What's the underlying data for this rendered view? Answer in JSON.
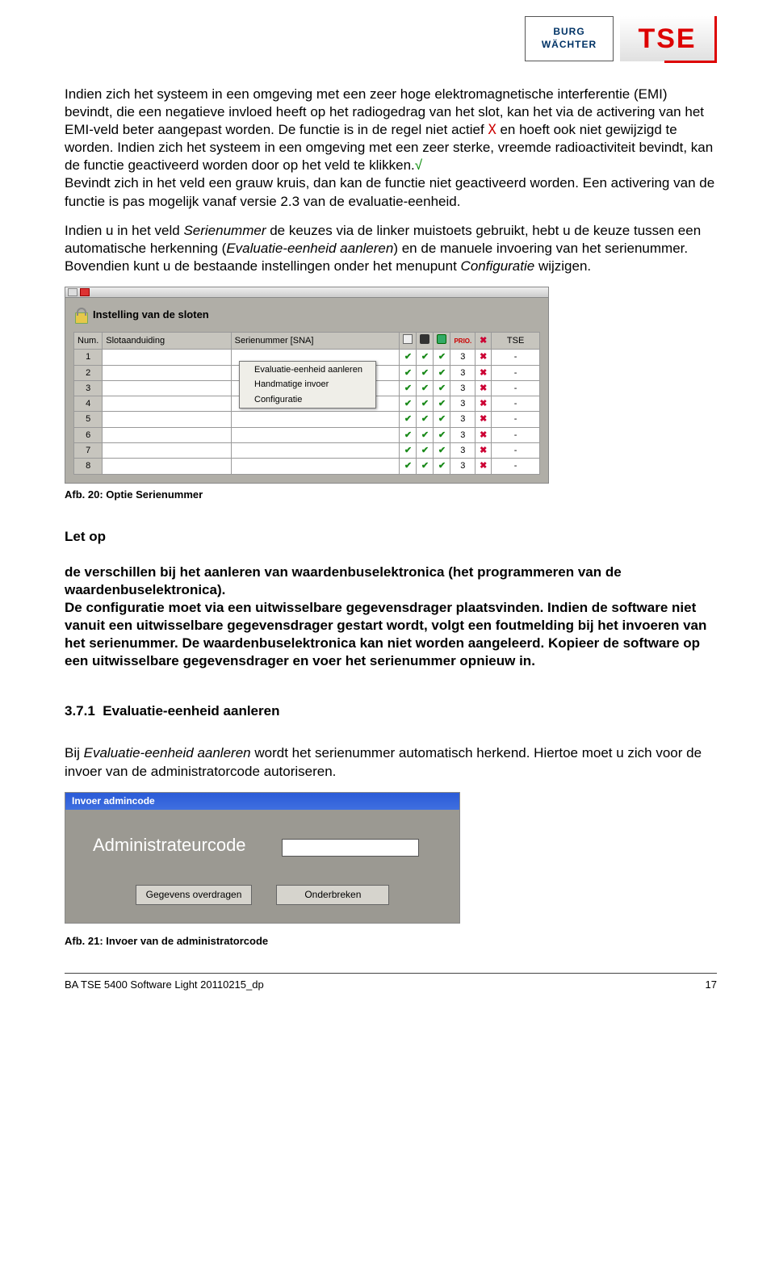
{
  "logo": {
    "bw_line1": "BURG",
    "bw_line2": "WÄCHTER",
    "tse": "TSE"
  },
  "para1_a": "Indien zich het systeem in een omgeving met een zeer hoge elektromagnetische interferentie (EMI) bevindt, die een negatieve invloed heeft op het radiogedrag van het slot, kan het via de activering van het EMI-veld beter aangepast worden. De functie is in de regel niet actief ",
  "para1_x": "X",
  "para1_b": " en hoeft ook niet gewijzigd te worden. Indien zich het systeem in een omgeving met een zeer sterke, vreemde radioactiviteit bevindt, kan de functie geactiveerd worden door op het veld te klikken.",
  "para1_tick": "√",
  "para1_c": "Bevindt zich in het veld een grauw kruis, dan kan de functie niet geactiveerd worden. Een activering van de functie is pas mogelijk vanaf versie 2.3 van de evaluatie-eenheid.",
  "para2_a": "Indien u in het veld ",
  "para2_ital1": "Serienummer",
  "para2_b": " de keuzes via de linker muistoets gebruikt, hebt u de keuze tussen een automatische herkenning (",
  "para2_ital2": "Evaluatie-eenheid aanleren",
  "para2_c": ") en de manuele invoering van het serienummer. Bovendien kunt u de bestaande instellingen onder het menupunt ",
  "para2_ital3": "Configuratie",
  "para2_d": " wijzigen.",
  "shot1": {
    "title": "Instelling van de sloten",
    "headers": {
      "num": "Num.",
      "sa": "Slotaanduiding",
      "sn": "Serienummer [SNA]",
      "pri": "PRIO.",
      "tse": "TSE"
    },
    "ctx": {
      "m1": "Evaluatie-eenheid aanleren",
      "m2": "Handmatige invoer",
      "m3": "Configuratie"
    },
    "rows": [
      {
        "n": "1",
        "p": "3",
        "t": "-"
      },
      {
        "n": "2",
        "p": "3",
        "t": "-"
      },
      {
        "n": "3",
        "p": "3",
        "t": "-"
      },
      {
        "n": "4",
        "p": "3",
        "t": "-"
      },
      {
        "n": "5",
        "p": "3",
        "t": "-"
      },
      {
        "n": "6",
        "p": "3",
        "t": "-"
      },
      {
        "n": "7",
        "p": "3",
        "t": "-"
      },
      {
        "n": "8",
        "p": "3",
        "t": "-"
      }
    ]
  },
  "caption1": "Afb. 20: Optie Serienummer",
  "letop": "Let op",
  "bold_para": " de verschillen bij het aanleren van waardenbuselektronica (het programmeren van de waardenbuselektronica).\nDe configuratie moet via een uitwisselbare gegevensdrager plaatsvinden. Indien de software niet vanuit een uitwisselbare gegevensdrager gestart wordt, volgt een foutmelding bij het invoeren van het serienummer. De waardenbuselektronica kan niet worden aangeleerd. Kopieer de software op een uitwisselbare gegevensdrager en voer het serienummer opnieuw in.",
  "section_num": "3.7.1",
  "section_title": "Evaluatie-eenheid aanleren",
  "para3_a": "Bij ",
  "para3_ital": "Evaluatie-eenheid aanleren",
  "para3_b": " wordt het serienummer automatisch herkend. Hiertoe moet u zich voor de invoer van de administratorcode autoriseren.",
  "shot2": {
    "title": "Invoer admincode",
    "label": "Administrateurcode",
    "btn1": "Gegevens overdragen",
    "btn2": "Onderbreken"
  },
  "caption2": "Afb. 21: Invoer van de administratorcode",
  "footer_left": "BA TSE 5400 Software Light 20110215_dp",
  "footer_right": "17"
}
